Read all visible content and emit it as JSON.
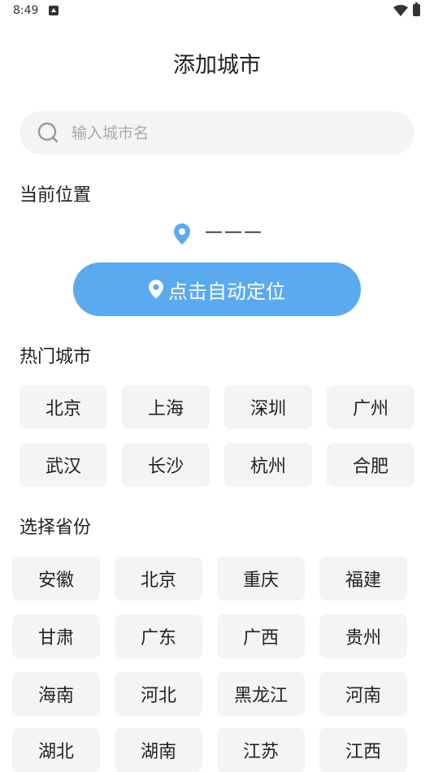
{
  "status_bar": {
    "time": "8:49"
  },
  "page": {
    "title": "添加城市"
  },
  "search": {
    "placeholder": "输入城市名",
    "value": ""
  },
  "current_location": {
    "heading": "当前位置",
    "value": "———"
  },
  "locate_button": {
    "label": "点击自动定位"
  },
  "hot_cities": {
    "heading": "热门城市",
    "items": [
      "北京",
      "上海",
      "深圳",
      "广州",
      "武汉",
      "长沙",
      "杭州",
      "合肥"
    ]
  },
  "provinces": {
    "heading": "选择省份",
    "items": [
      "安徽",
      "北京",
      "重庆",
      "福建",
      "甘肃",
      "广东",
      "广西",
      "贵州",
      "海南",
      "河北",
      "黑龙江",
      "河南",
      "湖北",
      "湖南",
      "江苏",
      "江西"
    ]
  },
  "colors": {
    "accent": "#5aaaf0",
    "chip_bg": "#f4f4f4"
  },
  "icons": {
    "search": "search-icon",
    "pin": "location-pin-icon"
  }
}
